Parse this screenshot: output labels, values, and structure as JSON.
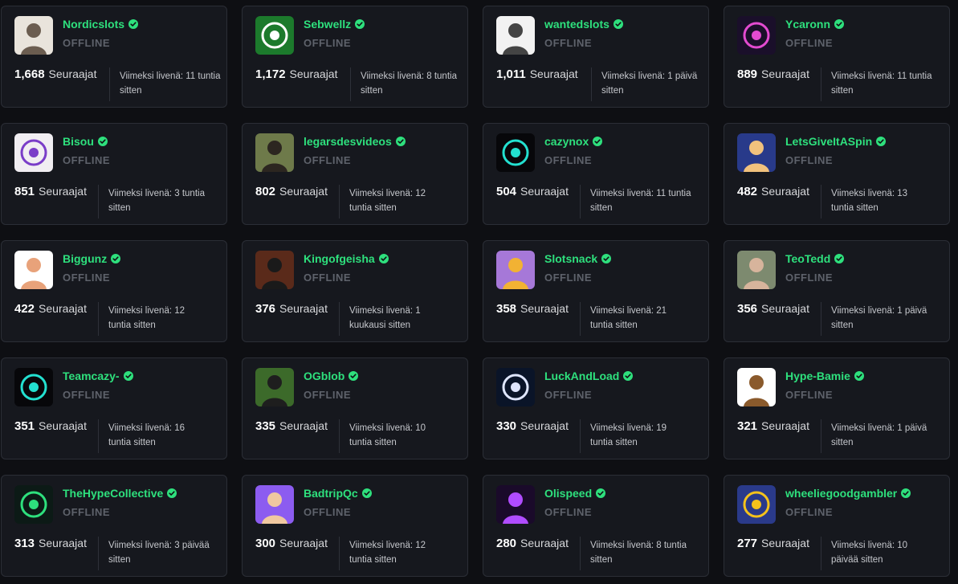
{
  "labels": {
    "followers": "Seuraajat",
    "status": "OFFLINE"
  },
  "colors": {
    "accent": "#2ee07d",
    "status": "#5e626b",
    "card_bg": "#16181e",
    "border": "#2b2e36"
  },
  "streamers": [
    {
      "name": "Nordicslots",
      "followers": "1,668",
      "last_live": "Viimeksi livenä: 11 tuntia sitten",
      "avatar_icon": "man-in-suit-avatar",
      "avatar_bg": "#e9e4dc"
    },
    {
      "name": "Sebwellz",
      "followers": "1,172",
      "last_live": "Viimeksi livenä: 8 tuntia sitten",
      "avatar_icon": "laps-logo-avatar",
      "avatar_bg": "#1c7a2c"
    },
    {
      "name": "wantedslots",
      "followers": "1,011",
      "last_live": "Viimeksi livenä: 1 päivä sitten",
      "avatar_icon": "wanted-poster-avatar",
      "avatar_bg": "#f2f2f2"
    },
    {
      "name": "Ycaronn",
      "followers": "889",
      "last_live": "Viimeksi livenä: 11 tuntia sitten",
      "avatar_icon": "yc-neon-logo-avatar",
      "avatar_bg": "#1a0f2a"
    },
    {
      "name": "Bisou",
      "followers": "851",
      "last_live": "Viimeksi livenä: 3 tuntia sitten",
      "avatar_icon": "bisou-logo-avatar",
      "avatar_bg": "#f1eef2"
    },
    {
      "name": "legarsdesvideos",
      "followers": "802",
      "last_live": "Viimeksi livenä: 12 tuntia sitten",
      "avatar_icon": "man-outdoors-avatar",
      "avatar_bg": "#6e7a4a"
    },
    {
      "name": "cazynox",
      "followers": "504",
      "last_live": "Viimeksi livenä: 11 tuntia sitten",
      "avatar_icon": "skull-logo-avatar",
      "avatar_bg": "#07070a"
    },
    {
      "name": "LetsGiveItASpin",
      "followers": "482",
      "last_live": "Viimeksi livenä: 13 tuntia sitten",
      "avatar_icon": "cartoon-man-avatar",
      "avatar_bg": "#283a8a"
    },
    {
      "name": "Biggunz",
      "followers": "422",
      "last_live": "Viimeksi livenä: 12 tuntia sitten",
      "avatar_icon": "flexed-arm-avatar",
      "avatar_bg": "#ffffff"
    },
    {
      "name": "Kingofgeisha",
      "followers": "376",
      "last_live": "Viimeksi livenä: 1 kuukausi sitten",
      "avatar_icon": "man-on-throne-avatar",
      "avatar_bg": "#5a2a1a"
    },
    {
      "name": "Slotsnack",
      "followers": "358",
      "last_live": "Viimeksi livenä: 21 tuntia sitten",
      "avatar_icon": "burger-mascot-avatar",
      "avatar_bg": "#a678d8"
    },
    {
      "name": "TeoTedd",
      "followers": "356",
      "last_live": "Viimeksi livenä: 1 päivä sitten",
      "avatar_icon": "man-portrait-avatar",
      "avatar_bg": "#7d8a6f"
    },
    {
      "name": "Teamcazy-",
      "followers": "351",
      "last_live": "Viimeksi livenä: 16 tuntia sitten",
      "avatar_icon": "skull-logo-avatar",
      "avatar_bg": "#07070a"
    },
    {
      "name": "OGblob",
      "followers": "335",
      "last_live": "Viimeksi livenä: 10 tuntia sitten",
      "avatar_icon": "golfer-avatar",
      "avatar_bg": "#3c6a2a"
    },
    {
      "name": "LuckAndLoad",
      "followers": "330",
      "last_live": "Viimeksi livenä: 19 tuntia sitten",
      "avatar_icon": "luck-and-load-logo-avatar",
      "avatar_bg": "#0a1428"
    },
    {
      "name": "Hype-Bamie",
      "followers": "321",
      "last_live": "Viimeksi livenä: 1 päivä sitten",
      "avatar_icon": "monkey-avatar",
      "avatar_bg": "#ffffff"
    },
    {
      "name": "TheHypeCollective",
      "followers": "313",
      "last_live": "Viimeksi livenä: 3 päivää sitten",
      "avatar_icon": "hype-collective-logo-avatar",
      "avatar_bg": "#0c1a16"
    },
    {
      "name": "BadtripQc",
      "followers": "300",
      "last_live": "Viimeksi livenä: 12 tuntia sitten",
      "avatar_icon": "smiling-man-avatar",
      "avatar_bg": "#8c5cf0"
    },
    {
      "name": "Olispeed",
      "followers": "280",
      "last_live": "Viimeksi livenä: 8 tuntia sitten",
      "avatar_icon": "gamer-silhouette-avatar",
      "avatar_bg": "#1a0a2a"
    },
    {
      "name": "wheeliegoodgambler",
      "followers": "277",
      "last_live": "Viimeksi livenä: 10 päivää sitten",
      "avatar_icon": "gambler-logo-avatar",
      "avatar_bg": "#2a3a8a"
    }
  ]
}
